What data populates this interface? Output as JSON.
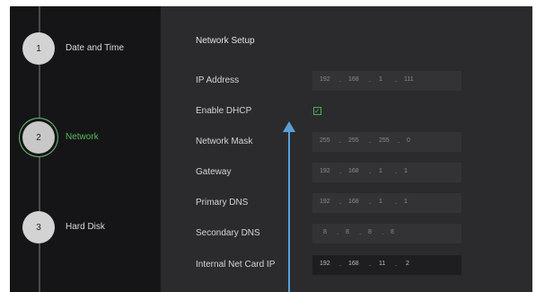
{
  "steps": [
    {
      "number": "1",
      "label": "Date and Time",
      "active": false
    },
    {
      "number": "2",
      "label": "Network",
      "active": true
    },
    {
      "number": "3",
      "label": "Hard Disk",
      "active": false
    }
  ],
  "section_title": "Network Setup",
  "fields": {
    "ip_address": {
      "label": "IP Address",
      "octets": [
        "192",
        "168",
        "1",
        "111"
      ]
    },
    "enable_dhcp": {
      "label": "Enable DHCP",
      "checked": true
    },
    "network_mask": {
      "label": "Network Mask",
      "octets": [
        "255",
        "255",
        "255",
        "0"
      ]
    },
    "gateway": {
      "label": "Gateway",
      "octets": [
        "192",
        "168",
        "1",
        "1"
      ]
    },
    "primary_dns": {
      "label": "Primary DNS",
      "octets": [
        "192",
        "168",
        "1",
        "1"
      ]
    },
    "secondary_dns": {
      "label": "Secondary DNS",
      "octets": [
        "8",
        "8",
        "8",
        "8"
      ]
    },
    "internal_net_card_ip": {
      "label": "Internal Net Card IP",
      "octets": [
        "192",
        "168",
        "11",
        "2"
      ]
    }
  },
  "colors": {
    "accent": "#58b85c",
    "annotation_arrow": "#5a9fd6"
  },
  "icons": {
    "dhcp_checkbox": "checkmark-icon",
    "annotation": "arrow-up-icon"
  }
}
